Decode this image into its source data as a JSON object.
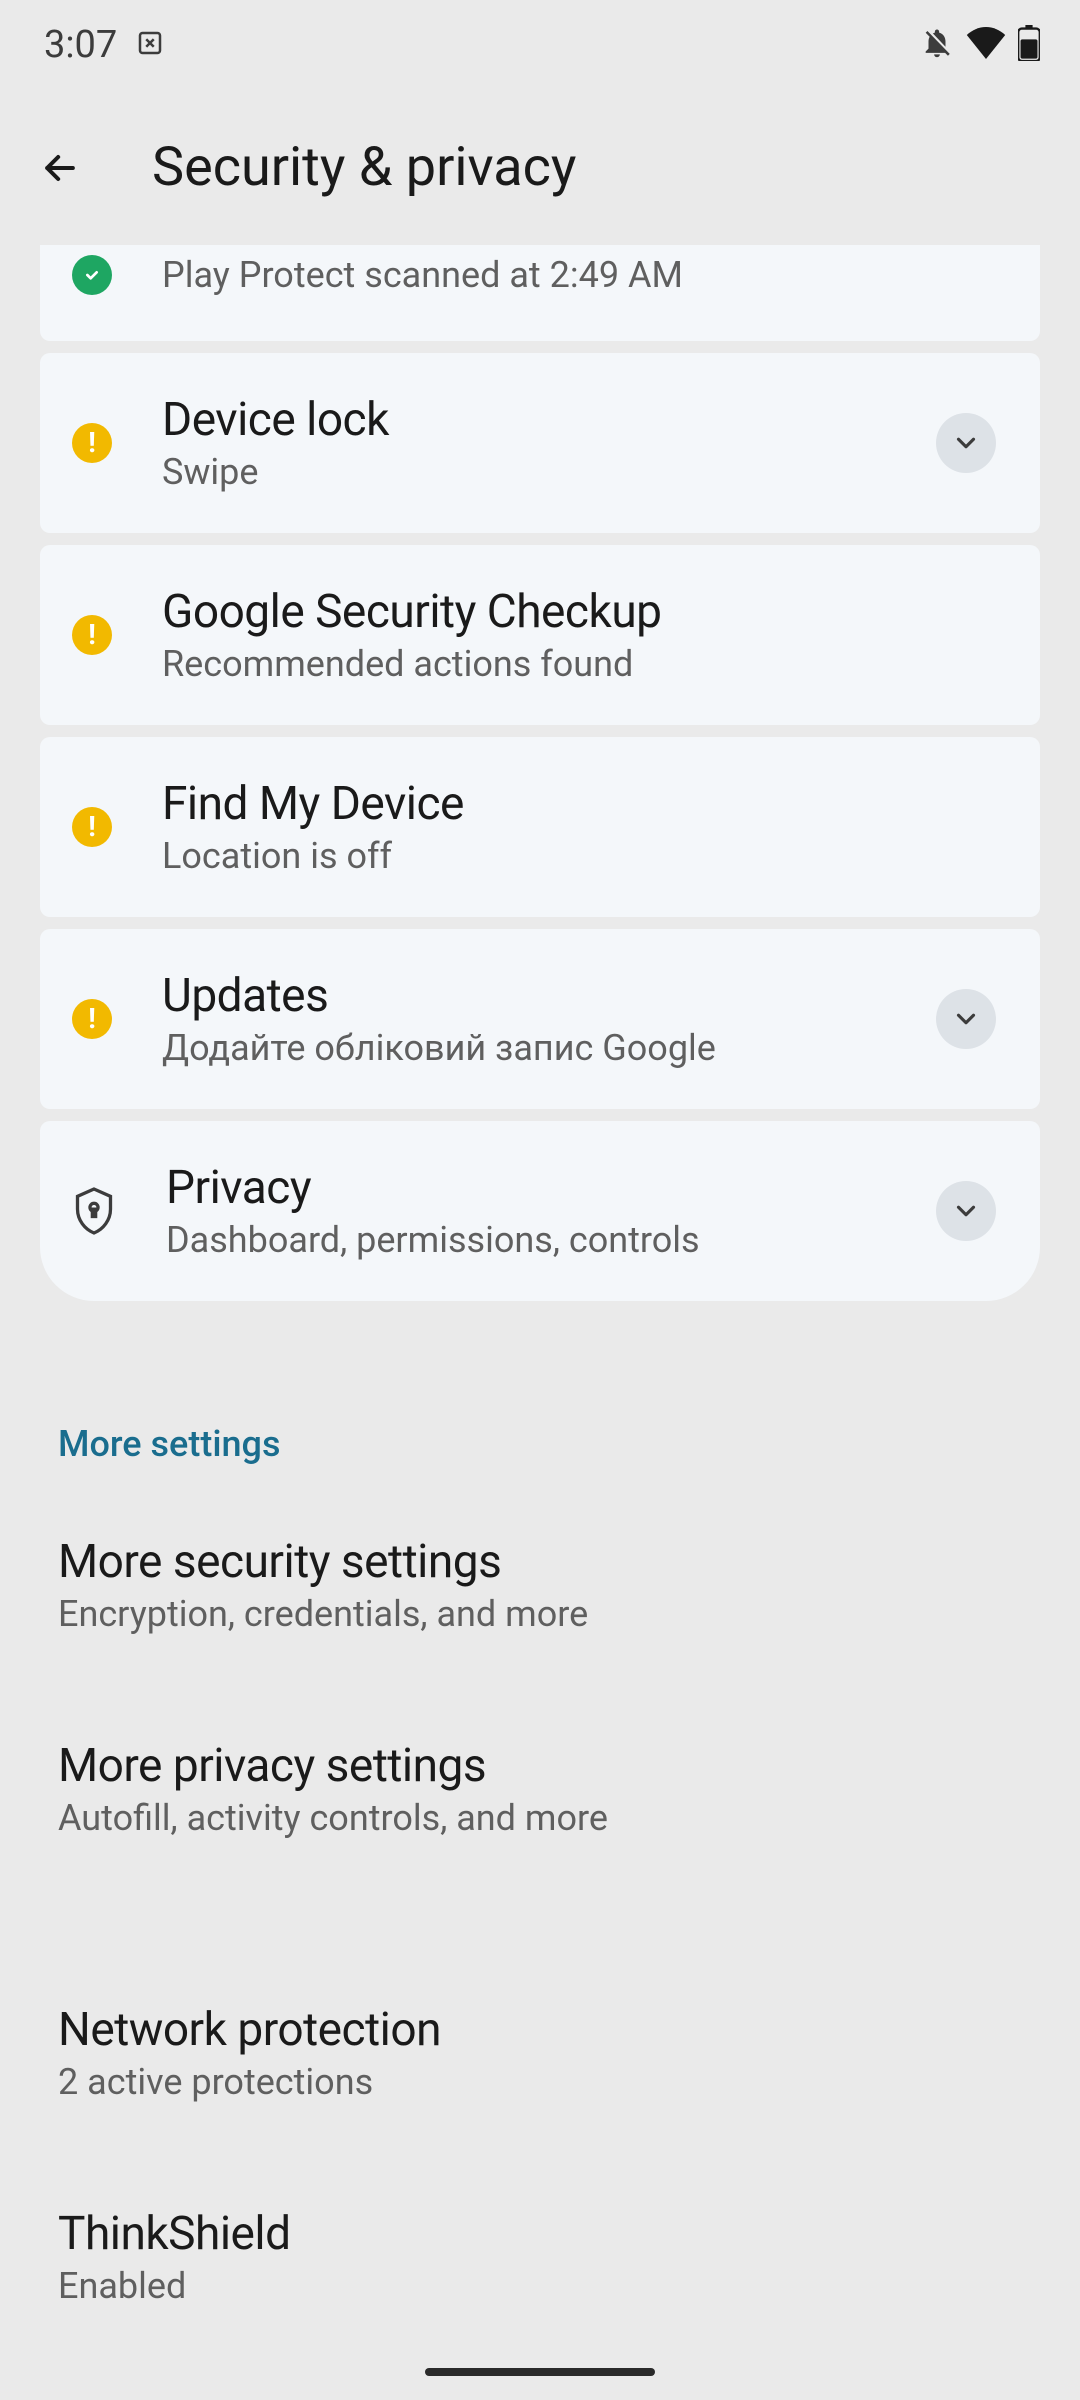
{
  "status": {
    "time": "3:07"
  },
  "header": {
    "title": "Security & privacy"
  },
  "cards": [
    {
      "subtitle": "Play Protect scanned at 2:49 AM"
    },
    {
      "title": "Device lock",
      "subtitle": "Swipe"
    },
    {
      "title": "Google Security Checkup",
      "subtitle": "Recommended actions found"
    },
    {
      "title": "Find My Device",
      "subtitle": "Location is off"
    },
    {
      "title": "Updates",
      "subtitle": "Додайте обліковий запис Google"
    },
    {
      "title": "Privacy",
      "subtitle": "Dashboard, permissions, controls"
    }
  ],
  "section_header": "More settings",
  "settings": [
    {
      "title": "More security settings",
      "subtitle": "Encryption, credentials, and more"
    },
    {
      "title": "More privacy settings",
      "subtitle": "Autofill, activity controls, and more"
    },
    {
      "title": "Network protection",
      "subtitle": "2 active protections"
    },
    {
      "title": "ThinkShield",
      "subtitle": "Enabled"
    }
  ]
}
